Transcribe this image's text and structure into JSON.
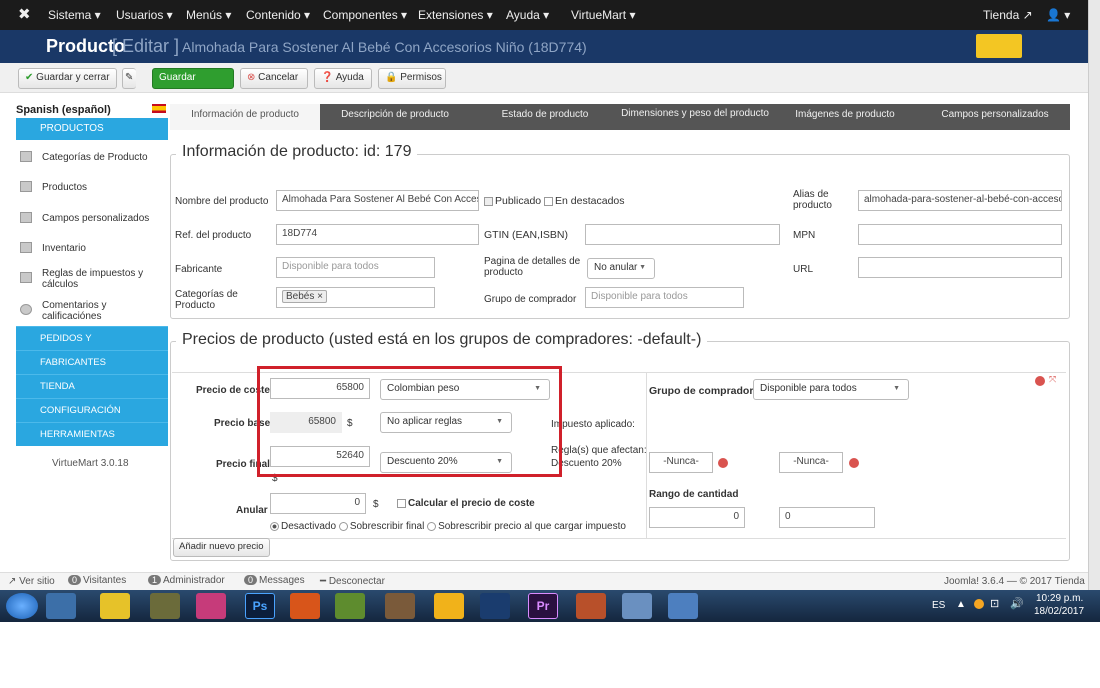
{
  "menubar": {
    "items": [
      "Sistema ▾",
      "Usuarios ▾",
      "Menús ▾",
      "Contenido ▾",
      "Componentes ▾",
      "Extensiones ▾",
      "Ayuda ▾",
      "VirtueMart ▾"
    ],
    "right": "Tienda",
    "user": "▾"
  },
  "title": {
    "section": "Producto",
    "mode": "[ Editar ]",
    "product": "Almohada Para Sostener Al Bebé Con Accesorios Niño (18D774)"
  },
  "toolbar": {
    "save_close": "Guardar y cerrar",
    "save": "Guardar",
    "cancel": "Cancelar",
    "help": "Ayuda",
    "permissions": "Permisos"
  },
  "sidebar": {
    "language": "Spanish (español)",
    "products_head": "PRODUCTOS",
    "items": [
      "Categorías de Producto",
      "Productos",
      "Campos personalizados",
      "Inventario",
      "Reglas de impuestos y cálculos",
      "Comentarios y calificaciónes"
    ],
    "heads": [
      "PEDIDOS Y",
      "FABRICANTES",
      "TIENDA",
      "CONFIGURACIÓN",
      "HERRAMIENTAS"
    ],
    "version": "VirtueMart 3.0.18"
  },
  "tabs": [
    "Información de producto",
    "Descripción de producto",
    "Estado de producto",
    "Dimensiones y peso del producto",
    "Imágenes de producto",
    "Campos personalizados"
  ],
  "info": {
    "legend": "Información de producto: id: 179",
    "name_label": "Nombre del producto",
    "name_value": "Almohada Para Sostener Al Bebé Con Accesorios",
    "published": "Publicado",
    "featured": "En destacados",
    "alias_label": "Alias de producto",
    "alias_value": "almohada-para-sostener-al-bebé-con-accesorios",
    "ref_label": "Ref. del producto",
    "ref_value": "18D774",
    "gtin_label": "GTIN (EAN,ISBN)",
    "mpn_label": "MPN",
    "maker_label": "Fabricante",
    "maker_value": "Disponible para todos",
    "detail_label": "Pagina de detalles de producto",
    "detail_value": "No anular",
    "url_label": "URL",
    "cat_label": "Categorías de Producto",
    "cat_value": "Bebés ×",
    "group_label": "Grupo de comprador",
    "group_value": "Disponible para todos"
  },
  "prices": {
    "legend": "Precios de producto (usted está en los grupos de compradores: -default-)",
    "cost_label": "Precio de coste",
    "cost_value": "65800",
    "currency": "Colombian peso",
    "base_label": "Precio base",
    "base_value": "65800",
    "base_unit": "$",
    "rule_value": "No aplicar reglas",
    "tax_label": "Impuesto aplicado:",
    "final_label": "Precio final",
    "final_value": "52640",
    "final_unit": "$",
    "discount_value": "Descuento 20%",
    "rules_label": "Regla(s) que afectan:",
    "rules_value": "Descuento 20%",
    "buyer_group_label": "Grupo de comprador",
    "buyer_group_value": "Disponible para todos",
    "never1": "-Nunca-",
    "never2": "-Nunca-",
    "override_label": "Anular",
    "override_value": "0",
    "override_unit": "$",
    "calc_cost": "Calcular el precio de coste",
    "qty_label": "Rango de cantidad",
    "qty_from": "0",
    "qty_to": "0",
    "opt_disabled": "Desactivado",
    "opt_final": "Sobrescribir final",
    "opt_tax": "Sobrescribir precio al que cargar impuesto",
    "add_price": "Añadir nuevo precio"
  },
  "status": {
    "site": "Ver sitio",
    "visitors_count": "0",
    "visitors": "Visitantes",
    "admin_count": "1",
    "admin": "Administrador",
    "msg_count": "0",
    "messages": "Messages",
    "logout": "Desconectar",
    "right": "Joomla! 3.6.4 — © 2017 Tienda"
  },
  "taskbar": {
    "lang": "ES",
    "time": "10:29 p.m.",
    "date": "18/02/2017",
    "ps_label": "Ps",
    "pr_label": "Pr"
  },
  "colors": {
    "accent": "#2aa7e0",
    "brand": "#1a3867",
    "highlight": "#d0202a"
  }
}
